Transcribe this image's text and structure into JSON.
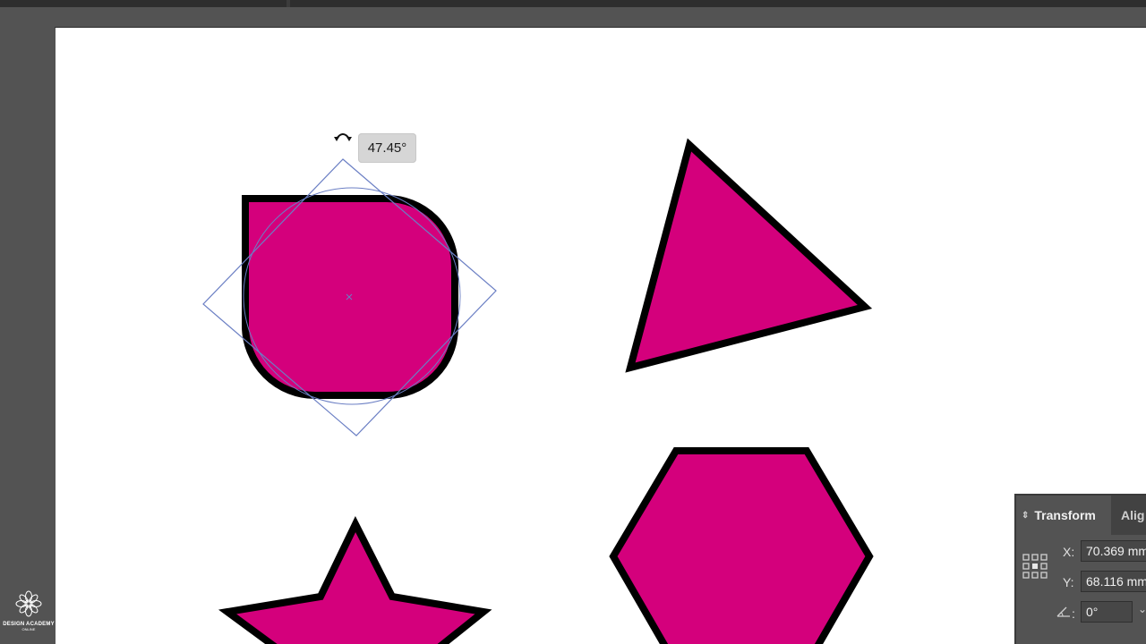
{
  "tooltip": {
    "rotation_angle": "47.45°"
  },
  "colors": {
    "shape_fill": "#d4007c",
    "shape_stroke": "#000000",
    "selection": "#6b7fc4",
    "artboard": "#ffffff",
    "ui_background": "#535353"
  },
  "canvas": {
    "shapes": [
      "rounded-square",
      "triangle",
      "star",
      "hexagon"
    ]
  },
  "transform_panel": {
    "active_tab": "Transform",
    "other_tab": "Alig",
    "x_label": "X:",
    "x_value": "70.369 mm",
    "y_label": "Y:",
    "y_value": "68.116 mm",
    "angle_label": ":",
    "angle_value": "0°"
  },
  "watermark": {
    "line1": "DESIGN ACADEMY",
    "line2": "ONLINE"
  }
}
